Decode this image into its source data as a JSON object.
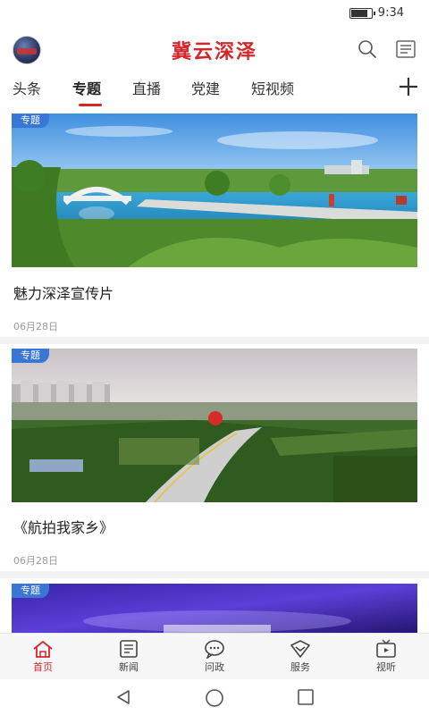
{
  "status": {
    "time": "9:34",
    "battery_level": 0.85
  },
  "header": {
    "title": "冀云深泽",
    "avatar_icon": "avatar-logo-icon",
    "search_icon": "search-icon",
    "doc_icon": "newspaper-icon"
  },
  "tabs": [
    {
      "label": "头条",
      "active": false
    },
    {
      "label": "专题",
      "active": true
    },
    {
      "label": "直播",
      "active": false
    },
    {
      "label": "党建",
      "active": false
    },
    {
      "label": "短视频",
      "active": false
    }
  ],
  "feed": [
    {
      "tag": "专题",
      "title": "魅力深泽宣传片",
      "date": "06月28日"
    },
    {
      "tag": "专题",
      "title": "《航拍我家乡》",
      "date": "06月28日"
    },
    {
      "tag": "专题",
      "title": "",
      "date": ""
    }
  ],
  "bottom_nav": [
    {
      "label": "首页",
      "icon": "home-icon",
      "active": true
    },
    {
      "label": "新闻",
      "icon": "news-icon",
      "active": false
    },
    {
      "label": "问政",
      "icon": "chat-icon",
      "active": false
    },
    {
      "label": "服务",
      "icon": "service-icon",
      "active": false
    },
    {
      "label": "视听",
      "icon": "tv-icon",
      "active": false
    }
  ],
  "colors": {
    "brand_red": "#d7262a",
    "tag_blue": "#3a76d6"
  }
}
